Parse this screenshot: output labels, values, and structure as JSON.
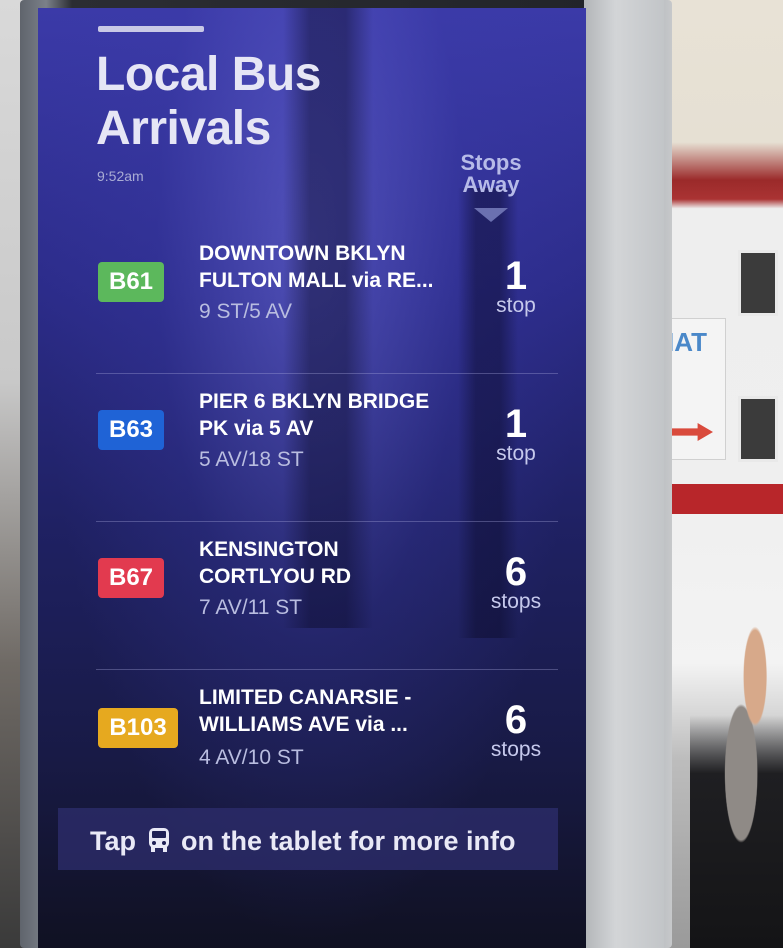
{
  "board": {
    "title": "Local Bus Arrivals",
    "time": "9:52am",
    "column_header": "Stops Away"
  },
  "arrivals": [
    {
      "route": "B61",
      "color": "#5cb85c",
      "destination_line1": "DOWNTOWN BKLYN",
      "destination_line2": "FULTON MALL via RE...",
      "stop": "9 ST/5 AV",
      "stops_away": "1",
      "unit": "stop"
    },
    {
      "route": "B63",
      "color": "#1f63d6",
      "destination_line1": "PIER 6 BKLYN BRIDGE",
      "destination_line2": "PK via 5 AV",
      "stop": "5 AV/18 ST",
      "stops_away": "1",
      "unit": "stop"
    },
    {
      "route": "B67",
      "color": "#e23a4f",
      "destination_line1": "KENSINGTON",
      "destination_line2": "CORTLYOU RD",
      "stop": "7 AV/11 ST",
      "stops_away": "6",
      "unit": "stops"
    },
    {
      "route": "B103",
      "color": "#e6a91f",
      "destination_line1": "LIMITED CANARSIE -",
      "destination_line2": "WILLIAMS AVE via ...",
      "stop": "4 AV/10 ST",
      "stops_away": "6",
      "unit": "stops"
    }
  ],
  "footer": {
    "text_before_icon": "Tap",
    "icon": "bus-icon",
    "text_after_icon": "on the tablet for more info"
  },
  "background_sign": {
    "text": "IAT"
  }
}
